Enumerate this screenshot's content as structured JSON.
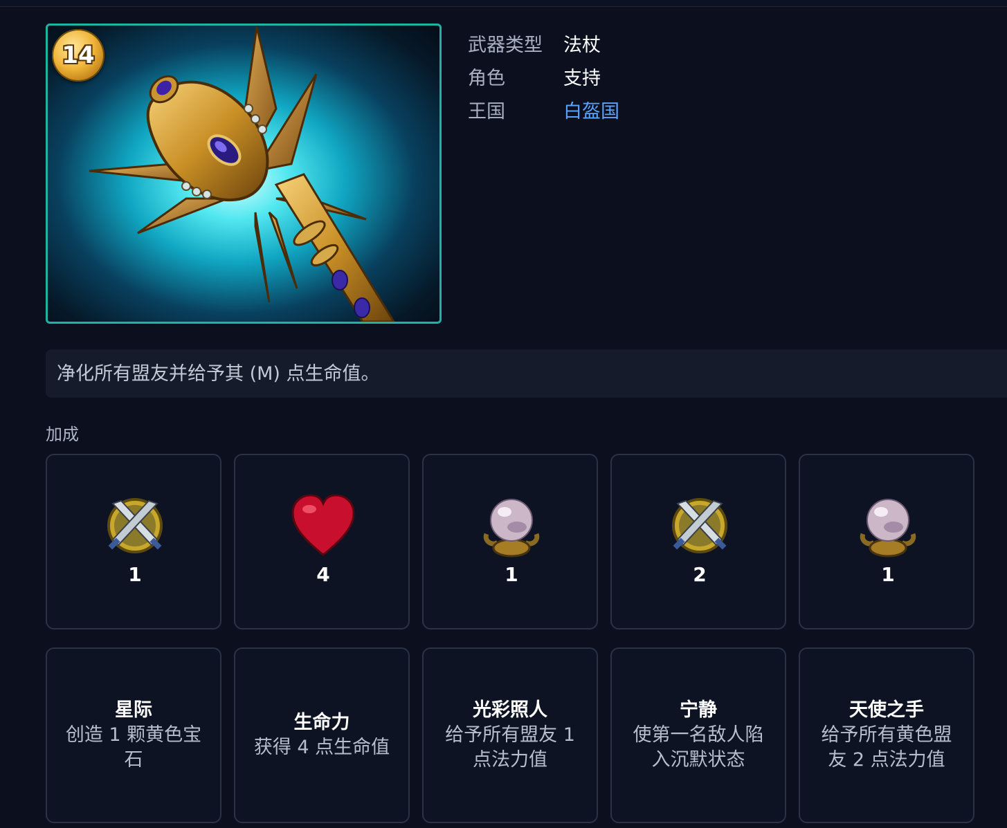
{
  "hero": {
    "level": "14",
    "icon": "staff-icon"
  },
  "info": {
    "weapon_type_label": "武器类型",
    "weapon_type_value": "法杖",
    "role_label": "角色",
    "role_value": "支持",
    "kingdom_label": "王国",
    "kingdom_value": "白盔国"
  },
  "description": "净化所有盟友并给予其 (M) 点生命值。",
  "bonus": {
    "label": "加成",
    "stats": [
      {
        "icon": "crossed-swords-icon",
        "value": "1"
      },
      {
        "icon": "heart-icon",
        "value": "4"
      },
      {
        "icon": "crystal-orb-icon",
        "value": "1"
      },
      {
        "icon": "crossed-swords-icon",
        "value": "2"
      },
      {
        "icon": "crystal-orb-icon",
        "value": "1"
      }
    ],
    "talents": [
      {
        "title": "星际",
        "desc": "创造 1 颗黄色宝石"
      },
      {
        "title": "生命力",
        "desc": "获得 4 点生命值"
      },
      {
        "title": "光彩照人",
        "desc": "给予所有盟友 1 点法力值"
      },
      {
        "title": "宁静",
        "desc": "使第一名敌人陷入沉默状态"
      },
      {
        "title": "天使之手",
        "desc": "给予所有黄色盟友 2 点法力值"
      }
    ]
  },
  "colors": {
    "frame_border": "#1fb3a4",
    "link": "#58a4ff",
    "background": "#0b0f1e"
  }
}
